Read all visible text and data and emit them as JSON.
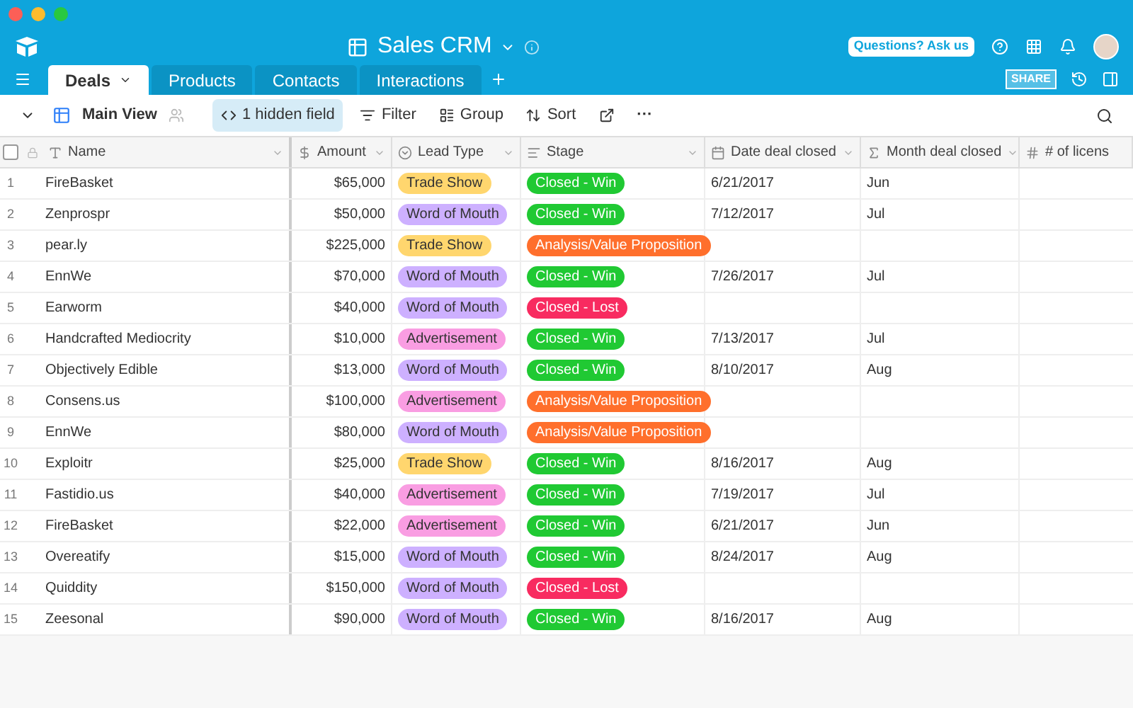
{
  "app": {
    "title": "Sales CRM",
    "help_button": "Questions? Ask us",
    "share_button": "SHARE"
  },
  "tabs": [
    {
      "label": "Deals",
      "selected": true
    },
    {
      "label": "Products",
      "selected": false
    },
    {
      "label": "Contacts",
      "selected": false
    },
    {
      "label": "Interactions",
      "selected": false
    }
  ],
  "toolbar": {
    "view": "Main View",
    "hidden_fields": "1 hidden field",
    "filter": "Filter",
    "group": "Group",
    "sort": "Sort",
    "more": "···"
  },
  "table": {
    "select_all_checked": false,
    "columns": [
      {
        "label": "Name",
        "kind": "text"
      },
      {
        "label": "Amount",
        "kind": "currency"
      },
      {
        "label": "Lead Type",
        "kind": "select"
      },
      {
        "label": "Stage",
        "kind": "list"
      },
      {
        "label": "Date deal closed",
        "kind": "date"
      },
      {
        "label": "Month deal closed",
        "kind": "formula"
      },
      {
        "label": "# of licens",
        "kind": "number"
      }
    ],
    "rows": [
      {
        "n": "1",
        "name": "FireBasket",
        "amount": "$65,000",
        "lead": {
          "label": "Trade Show",
          "color": "#ffd66e"
        },
        "stage": {
          "label": "Closed - Win",
          "color": "#20c933"
        },
        "date": "6/21/2017",
        "month": "Jun"
      },
      {
        "n": "2",
        "name": "Zenprospr",
        "amount": "$50,000",
        "lead": {
          "label": "Word of Mouth",
          "color": "#cdb0ff"
        },
        "stage": {
          "label": "Closed - Win",
          "color": "#20c933"
        },
        "date": "7/12/2017",
        "month": "Jul"
      },
      {
        "n": "3",
        "name": "pear.ly",
        "amount": "$225,000",
        "lead": {
          "label": "Trade Show",
          "color": "#ffd66e"
        },
        "stage": {
          "label": "Analysis/Value Proposition",
          "color": "#ff6f2c"
        }
      },
      {
        "n": "4",
        "name": "EnnWe",
        "amount": "$70,000",
        "lead": {
          "label": "Word of Mouth",
          "color": "#cdb0ff"
        },
        "stage": {
          "label": "Closed - Win",
          "color": "#20c933"
        },
        "date": "7/26/2017",
        "month": "Jul"
      },
      {
        "n": "5",
        "name": "Earworm",
        "amount": "$40,000",
        "lead": {
          "label": "Word of Mouth",
          "color": "#cdb0ff"
        },
        "stage": {
          "label": "Closed - Lost",
          "color": "#f82b60"
        }
      },
      {
        "n": "6",
        "name": "Handcrafted Mediocrity",
        "amount": "$10,000",
        "lead": {
          "label": "Advertisement",
          "color": "#f99de2"
        },
        "stage": {
          "label": "Closed - Win",
          "color": "#20c933"
        },
        "date": "7/13/2017",
        "month": "Jul"
      },
      {
        "n": "7",
        "name": "Objectively Edible",
        "amount": "$13,000",
        "lead": {
          "label": "Word of Mouth",
          "color": "#cdb0ff"
        },
        "stage": {
          "label": "Closed - Win",
          "color": "#20c933"
        },
        "date": "8/10/2017",
        "month": "Aug"
      },
      {
        "n": "8",
        "name": "Consens.us",
        "amount": "$100,000",
        "lead": {
          "label": "Advertisement",
          "color": "#f99de2"
        },
        "stage": {
          "label": "Analysis/Value Proposition",
          "color": "#ff6f2c"
        }
      },
      {
        "n": "9",
        "name": "EnnWe",
        "amount": "$80,000",
        "lead": {
          "label": "Word of Mouth",
          "color": "#cdb0ff"
        },
        "stage": {
          "label": "Analysis/Value Proposition",
          "color": "#ff6f2c"
        }
      },
      {
        "n": "10",
        "name": "Exploitr",
        "amount": "$25,000",
        "lead": {
          "label": "Trade Show",
          "color": "#ffd66e"
        },
        "stage": {
          "label": "Closed - Win",
          "color": "#20c933"
        },
        "date": "8/16/2017",
        "month": "Aug"
      },
      {
        "n": "11",
        "name": "Fastidio.us",
        "amount": "$40,000",
        "lead": {
          "label": "Advertisement",
          "color": "#f99de2"
        },
        "stage": {
          "label": "Closed - Win",
          "color": "#20c933"
        },
        "date": "7/19/2017",
        "month": "Jul"
      },
      {
        "n": "12",
        "name": "FireBasket",
        "amount": "$22,000",
        "lead": {
          "label": "Advertisement",
          "color": "#f99de2"
        },
        "stage": {
          "label": "Closed - Win",
          "color": "#20c933"
        },
        "date": "6/21/2017",
        "month": "Jun"
      },
      {
        "n": "13",
        "name": "Overeatify",
        "amount": "$15,000",
        "lead": {
          "label": "Word of Mouth",
          "color": "#cdb0ff"
        },
        "stage": {
          "label": "Closed - Win",
          "color": "#20c933"
        },
        "date": "8/24/2017",
        "month": "Aug"
      },
      {
        "n": "14",
        "name": "Quiddity",
        "amount": "$150,000",
        "lead": {
          "label": "Word of Mouth",
          "color": "#cdb0ff"
        },
        "stage": {
          "label": "Closed - Lost",
          "color": "#f82b60"
        }
      },
      {
        "n": "15",
        "name": "Zeesonal",
        "amount": "$90,000",
        "lead": {
          "label": "Word of Mouth",
          "color": "#cdb0ff"
        },
        "stage": {
          "label": "Closed - Win",
          "color": "#20c933"
        },
        "date": "8/16/2017",
        "month": "Aug"
      }
    ]
  }
}
